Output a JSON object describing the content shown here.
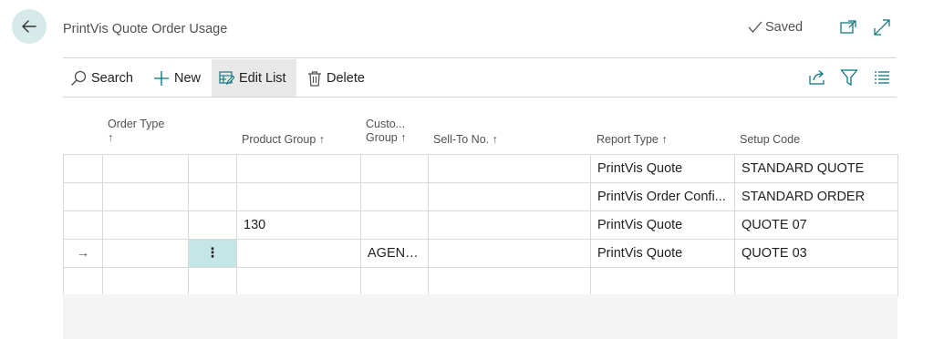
{
  "header": {
    "title": "PrintVis Quote Order Usage",
    "status": "Saved"
  },
  "toolbar": {
    "search": "Search",
    "new": "New",
    "edit_list": "Edit List",
    "delete": "Delete"
  },
  "columns": {
    "order_type_l1": "Order Type",
    "order_type_l2": "↑",
    "product_group": "Product Group ↑",
    "customer_group_l1": "Custo...",
    "customer_group_l2": "Group ↑",
    "sell_to_no": "Sell-To No. ↑",
    "report_type": "Report Type ↑",
    "setup_code": "Setup Code"
  },
  "rows": [
    {
      "indicator": "",
      "order_type": "",
      "action": "",
      "product_group": "",
      "customer_group": "",
      "sell_to_no": "",
      "report_type": "PrintVis Quote",
      "setup_code": "STANDARD QUOTE"
    },
    {
      "indicator": "",
      "order_type": "",
      "action": "",
      "product_group": "",
      "customer_group": "",
      "sell_to_no": "",
      "report_type": "PrintVis Order Confi...",
      "setup_code": "STANDARD ORDER"
    },
    {
      "indicator": "",
      "order_type": "",
      "action": "",
      "product_group": "130",
      "customer_group": "",
      "sell_to_no": "",
      "report_type": "PrintVis Quote",
      "setup_code": "QUOTE 07"
    },
    {
      "indicator": "→",
      "order_type": "",
      "action": "⋮",
      "product_group": "",
      "customer_group": "AGENCY",
      "sell_to_no": "",
      "report_type": "PrintVis Quote",
      "setup_code": "QUOTE 03"
    },
    {
      "indicator": "",
      "order_type": "",
      "action": "",
      "product_group": "",
      "customer_group": "",
      "sell_to_no": "",
      "report_type": "",
      "setup_code": ""
    }
  ],
  "colors": {
    "accent": "#00717a",
    "selected_cell": "#c5e6e7",
    "back_button": "#d6eaea"
  }
}
